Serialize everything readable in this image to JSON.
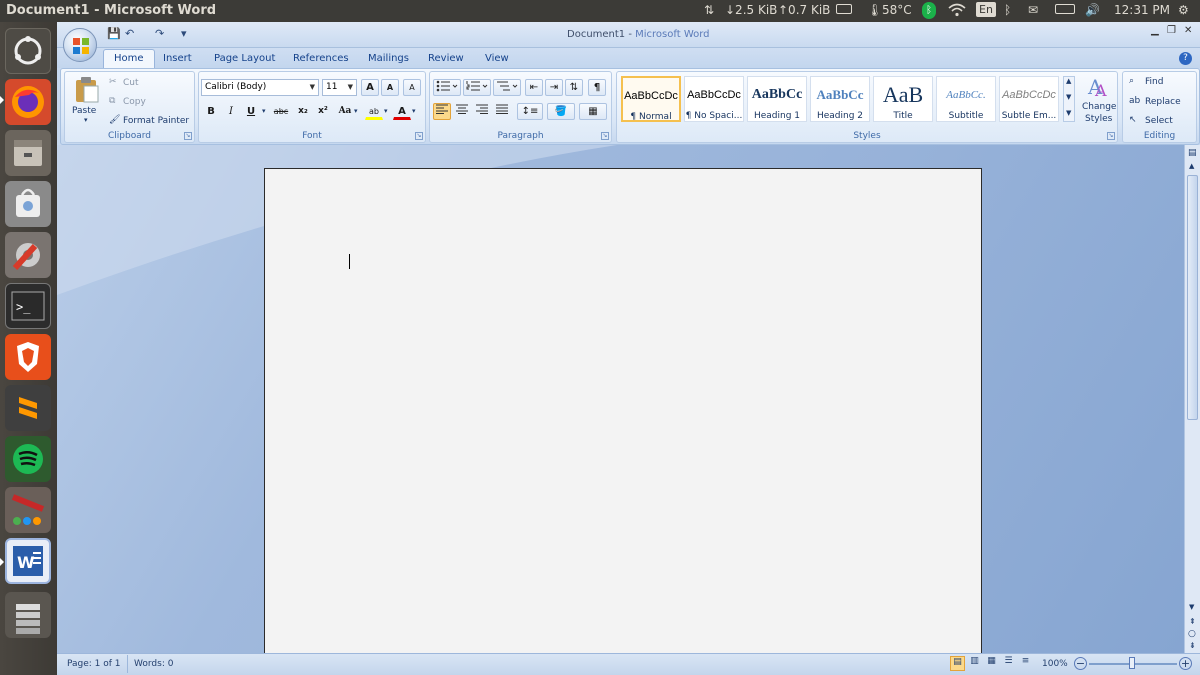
{
  "topbar": {
    "window_title": "Document1 - Microsoft Word",
    "net_down": "↓2.5 KiB",
    "net_up": "↑0.7 KiB",
    "temperature": "58°C",
    "keyboard_layout": "En",
    "clock": "12:31 PM"
  },
  "launcher": {
    "items": [
      "Ubuntu Dash",
      "Firefox",
      "Files",
      "Ubuntu Software",
      "System Settings",
      "Terminal",
      "Brave",
      "Sublime Text",
      "Spotify",
      "Wine",
      "Microsoft Word",
      "Trash"
    ]
  },
  "window": {
    "title_doc": "Document1",
    "title_sep": " - ",
    "title_app": "Microsoft Word"
  },
  "qat": {
    "save": "💾",
    "undo": "↶",
    "redo": "↷",
    "customize": "▾"
  },
  "tabs": [
    "Home",
    "Insert",
    "Page Layout",
    "References",
    "Mailings",
    "Review",
    "View"
  ],
  "clipboard": {
    "label": "Clipboard",
    "paste": "Paste",
    "cut": "Cut",
    "copy": "Copy",
    "format_painter": "Format Painter"
  },
  "font": {
    "label": "Font",
    "font_name": "Calibri (Body)",
    "font_size": "11",
    "grow": "A",
    "shrink": "A",
    "clear": "A",
    "bold": "B",
    "italic": "I",
    "underline": "U",
    "strike": "abc",
    "sub": "x₂",
    "sup": "x²",
    "case": "Aa",
    "highlight": "ab",
    "font_color": "A",
    "highlight_color": "#ffff00",
    "font_color_value": "#e00000"
  },
  "paragraph": {
    "label": "Paragraph",
    "show_marks": "¶"
  },
  "styles": {
    "label": "Styles",
    "tiles": [
      {
        "sample": "AaBbCcDc",
        "name": "¶ Normal"
      },
      {
        "sample": "AaBbCcDc",
        "name": "¶ No Spaci..."
      },
      {
        "sample": "AaBbCc",
        "name": "Heading 1"
      },
      {
        "sample": "AaBbCc",
        "name": "Heading 2"
      },
      {
        "sample": "AaB",
        "name": "Title"
      },
      {
        "sample": "AaBbCc.",
        "name": "Subtitle"
      },
      {
        "sample": "AaBbCcDc",
        "name": "Subtle Em..."
      }
    ],
    "change_styles_line1": "Change",
    "change_styles_line2": "Styles"
  },
  "editing": {
    "label": "Editing",
    "find": "Find",
    "replace": "Replace",
    "select": "Select"
  },
  "status": {
    "page": "Page: 1 of 1",
    "words": "Words: 0",
    "zoom": "100%",
    "zoom_level": 1.0
  },
  "colors": {
    "accent": "#15428b",
    "ribbon": "#dbe7f6",
    "ubuntu_panel": "#3c3b37"
  }
}
